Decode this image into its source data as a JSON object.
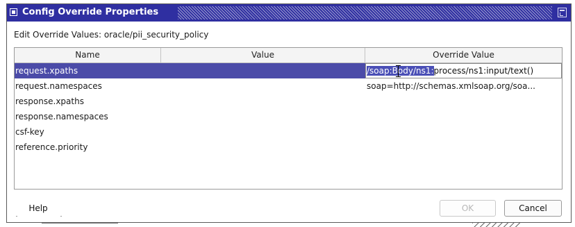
{
  "dialog": {
    "title": "Config Override Properties",
    "header_label": "Edit Override Values: oracle/pii_security_policy"
  },
  "table": {
    "columns": [
      "Name",
      "Value",
      "Override Value"
    ],
    "rows": [
      {
        "name": "request.xpaths",
        "value": "",
        "override": "/soap:Body/ns1:process/ns1:input/text()",
        "selected": true
      },
      {
        "name": "request.namespaces",
        "value": "",
        "override": "soap=http://schemas.xmlsoap.org/soa..."
      },
      {
        "name": "response.xpaths",
        "value": "",
        "override": ""
      },
      {
        "name": "response.namespaces",
        "value": "",
        "override": ""
      },
      {
        "name": "csf-key",
        "value": "",
        "override": ""
      },
      {
        "name": "reference.priority",
        "value": "",
        "override": ""
      }
    ],
    "editor": {
      "selected_text": "/soap:Body/ns1:",
      "rest_text": "process/ns1:input/text()"
    }
  },
  "buttons": {
    "help": "Help",
    "ok": "OK",
    "cancel": "Cancel"
  },
  "colors": {
    "titlebar": "#2f2fa1",
    "selection": "#4b4ba8"
  }
}
